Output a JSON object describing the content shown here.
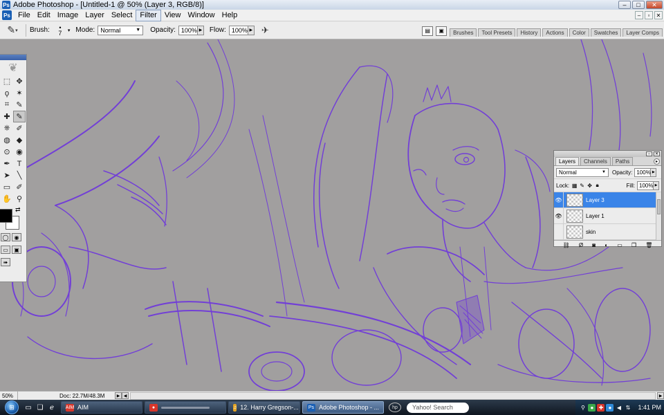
{
  "window": {
    "title": "Adobe Photoshop - [Untitled-1 @ 50% (Layer 3, RGB/8)]",
    "app_icon": "Ps",
    "minimize": "–",
    "maximize": "□",
    "close": "✕"
  },
  "menu": {
    "items": [
      "File",
      "Edit",
      "Image",
      "Layer",
      "Select",
      "Filter",
      "View",
      "Window",
      "Help"
    ],
    "active": "Filter",
    "doc_controls": [
      "–",
      "▫",
      "✕"
    ]
  },
  "options": {
    "brush_label": "Brush:",
    "brush_size": "7",
    "mode_label": "Mode:",
    "mode_value": "Normal",
    "opacity_label": "Opacity:",
    "opacity_value": "100%",
    "flow_label": "Flow:",
    "flow_value": "100%",
    "well_tabs": [
      "Brushes",
      "Tool Presets",
      "History",
      "Actions",
      "Color",
      "Swatches",
      "Layer Comps"
    ]
  },
  "tools": {
    "rows": [
      [
        "⬚",
        "✥"
      ],
      [
        "ϙ",
        "✶"
      ],
      [
        "⌗",
        "✎"
      ],
      [
        "✚",
        "✎"
      ],
      [
        "⎈",
        "✐"
      ],
      [
        "◍",
        "◆"
      ],
      [
        "⊙",
        "◉"
      ],
      [
        "✒",
        "T"
      ],
      [
        "➤",
        "╲"
      ],
      [
        "▭",
        "✐"
      ],
      [
        "✋",
        "⚲"
      ]
    ],
    "active_index": 7,
    "swap": "⇄"
  },
  "layers_panel": {
    "tabs": [
      "Layers",
      "Channels",
      "Paths"
    ],
    "active_tab": "Layers",
    "blend_mode": "Normal",
    "opacity_label": "Opacity:",
    "opacity_value": "100%",
    "lock_label": "Lock:",
    "fill_label": "Fill:",
    "fill_value": "100%",
    "layers": [
      {
        "name": "Layer 3",
        "visible": true,
        "selected": true
      },
      {
        "name": "Layer 1",
        "visible": true,
        "selected": false
      },
      {
        "name": "skin",
        "visible": false,
        "selected": false
      }
    ],
    "accent": "#3a84e8"
  },
  "status": {
    "zoom": "50%",
    "doc": "Doc: 22.7M/48.3M"
  },
  "taskbar": {
    "tasks": [
      {
        "label": "AIM",
        "icon": "AIM",
        "color": "#d8362b",
        "active": false
      },
      {
        "label": "",
        "icon": "●",
        "color": "#d8362b",
        "active": false
      },
      {
        "label": "12. Harry Gregson-...",
        "icon": "♫",
        "color": "#e4a422",
        "active": false
      },
      {
        "label": "Adobe Photoshop - ...",
        "icon": "Ps",
        "color": "#1a5fb4",
        "active": true
      }
    ],
    "search_placeholder": "Yahoo! Search",
    "clock": "1:41 PM"
  },
  "canvas": {
    "stroke_color": "#6a2fe0",
    "background": "#a19f9f"
  }
}
